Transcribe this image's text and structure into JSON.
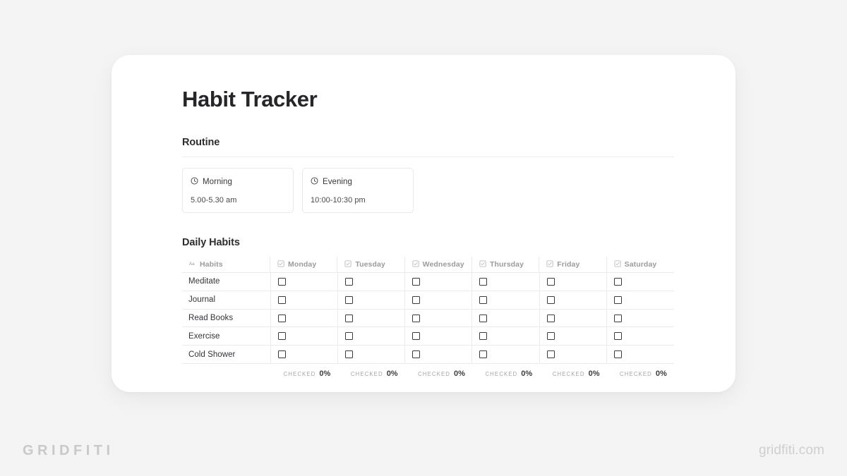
{
  "page": {
    "background_color": "#f4f4f4",
    "card_background": "#ffffff"
  },
  "document": {
    "title": "Habit Tracker"
  },
  "routine": {
    "heading": "Routine",
    "cards": [
      {
        "icon": "clock-icon",
        "label": "Morning",
        "time": "5.00-5.30 am"
      },
      {
        "icon": "clock-icon",
        "label": "Evening",
        "time": "10:00-10:30 pm"
      }
    ]
  },
  "daily_habits": {
    "heading": "Daily Habits",
    "columns": [
      {
        "label": "Habits",
        "icon": "text-type-icon"
      },
      {
        "label": "Monday",
        "icon": "checkbox-type-icon"
      },
      {
        "label": "Tuesday",
        "icon": "checkbox-type-icon"
      },
      {
        "label": "Wednesday",
        "icon": "checkbox-type-icon"
      },
      {
        "label": "Thursday",
        "icon": "checkbox-type-icon"
      },
      {
        "label": "Friday",
        "icon": "checkbox-type-icon"
      },
      {
        "label": "Saturday",
        "icon": "checkbox-type-icon"
      }
    ],
    "rows": [
      {
        "habit": "Meditate",
        "checks": [
          false,
          false,
          false,
          false,
          false,
          false
        ]
      },
      {
        "habit": "Journal",
        "checks": [
          false,
          false,
          false,
          false,
          false,
          false
        ]
      },
      {
        "habit": "Read Books",
        "checks": [
          false,
          false,
          false,
          false,
          false,
          false
        ]
      },
      {
        "habit": "Exercise",
        "checks": [
          false,
          false,
          false,
          false,
          false,
          false
        ]
      },
      {
        "habit": "Cold Shower",
        "checks": [
          false,
          false,
          false,
          false,
          false,
          false
        ]
      }
    ],
    "footer": {
      "label": "CHECKED",
      "values": [
        "0%",
        "0%",
        "0%",
        "0%",
        "0%",
        "0%"
      ]
    }
  },
  "branding": {
    "wordmark": "GRIDFITI",
    "website": "gridfiti.com"
  }
}
